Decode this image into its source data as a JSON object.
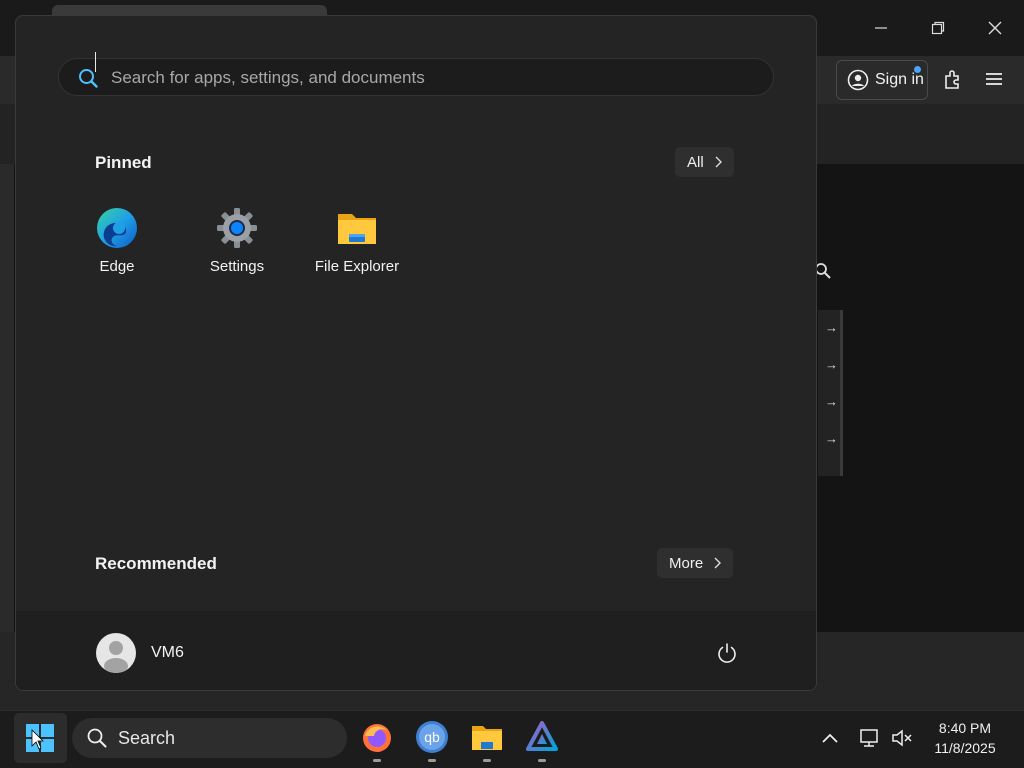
{
  "start_menu": {
    "search": {
      "placeholder": "Search for apps, settings, and documents",
      "value": ""
    },
    "pinned": {
      "title": "Pinned",
      "all_label": "All",
      "apps": [
        {
          "label": "Edge",
          "icon": "edge-icon"
        },
        {
          "label": "Settings",
          "icon": "settings-gear-icon"
        },
        {
          "label": "File Explorer",
          "icon": "folder-icon"
        }
      ]
    },
    "recommended": {
      "title": "Recommended",
      "more_label": "More"
    },
    "user": {
      "name": "VM6"
    }
  },
  "browser": {
    "signin_label": "Sign in"
  },
  "taskbar": {
    "search_label": "Search",
    "apps": [
      "firefox-icon",
      "qbittorrent-icon",
      "file-explorer-icon",
      "jellyfin-icon"
    ],
    "clock": {
      "time": "8:40 PM",
      "date": "11/8/2025"
    }
  },
  "colors": {
    "accent": "#0a84ff",
    "menu_bg": "#242424",
    "taskbar_bg": "#1c1c1c"
  }
}
